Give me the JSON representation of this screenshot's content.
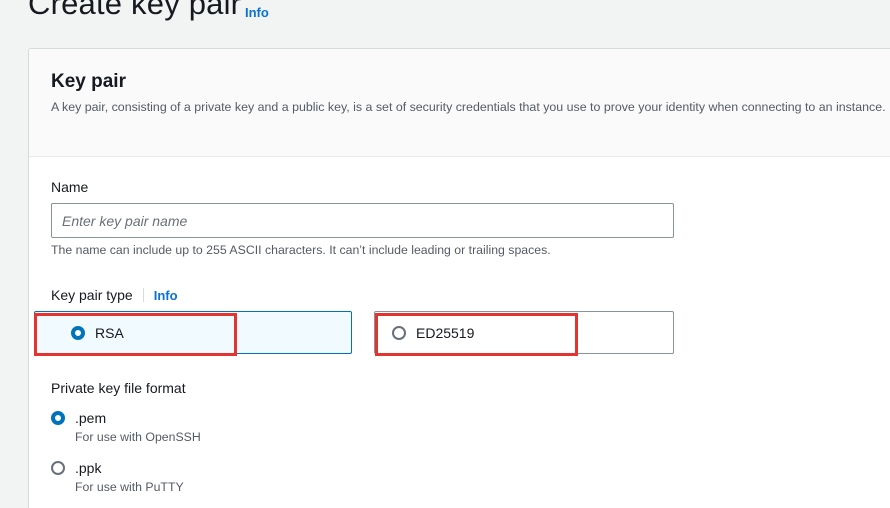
{
  "page": {
    "title": "Create key pair",
    "title_info": "Info"
  },
  "panel": {
    "title": "Key pair",
    "description": "A key pair, consisting of a private key and a public key, is a set of security credentials that you use to prove your identity when connecting to an instance."
  },
  "name_field": {
    "label": "Name",
    "placeholder": "Enter key pair name",
    "value": "",
    "hint": "The name can include up to 255 ASCII characters. It can’t include leading or trailing spaces."
  },
  "key_type": {
    "label": "Key pair type",
    "info": "Info",
    "options": [
      {
        "label": "RSA",
        "selected": true
      },
      {
        "label": "ED25519",
        "selected": false
      }
    ]
  },
  "file_format": {
    "label": "Private key file format",
    "options": [
      {
        "label": ".pem",
        "description": "For use with OpenSSH",
        "selected": true
      },
      {
        "label": ".ppk",
        "description": "For use with PuTTY",
        "selected": false
      }
    ]
  },
  "colors": {
    "accent": "#0073bb",
    "link": "#0972d3",
    "highlight": "#e3342f"
  }
}
